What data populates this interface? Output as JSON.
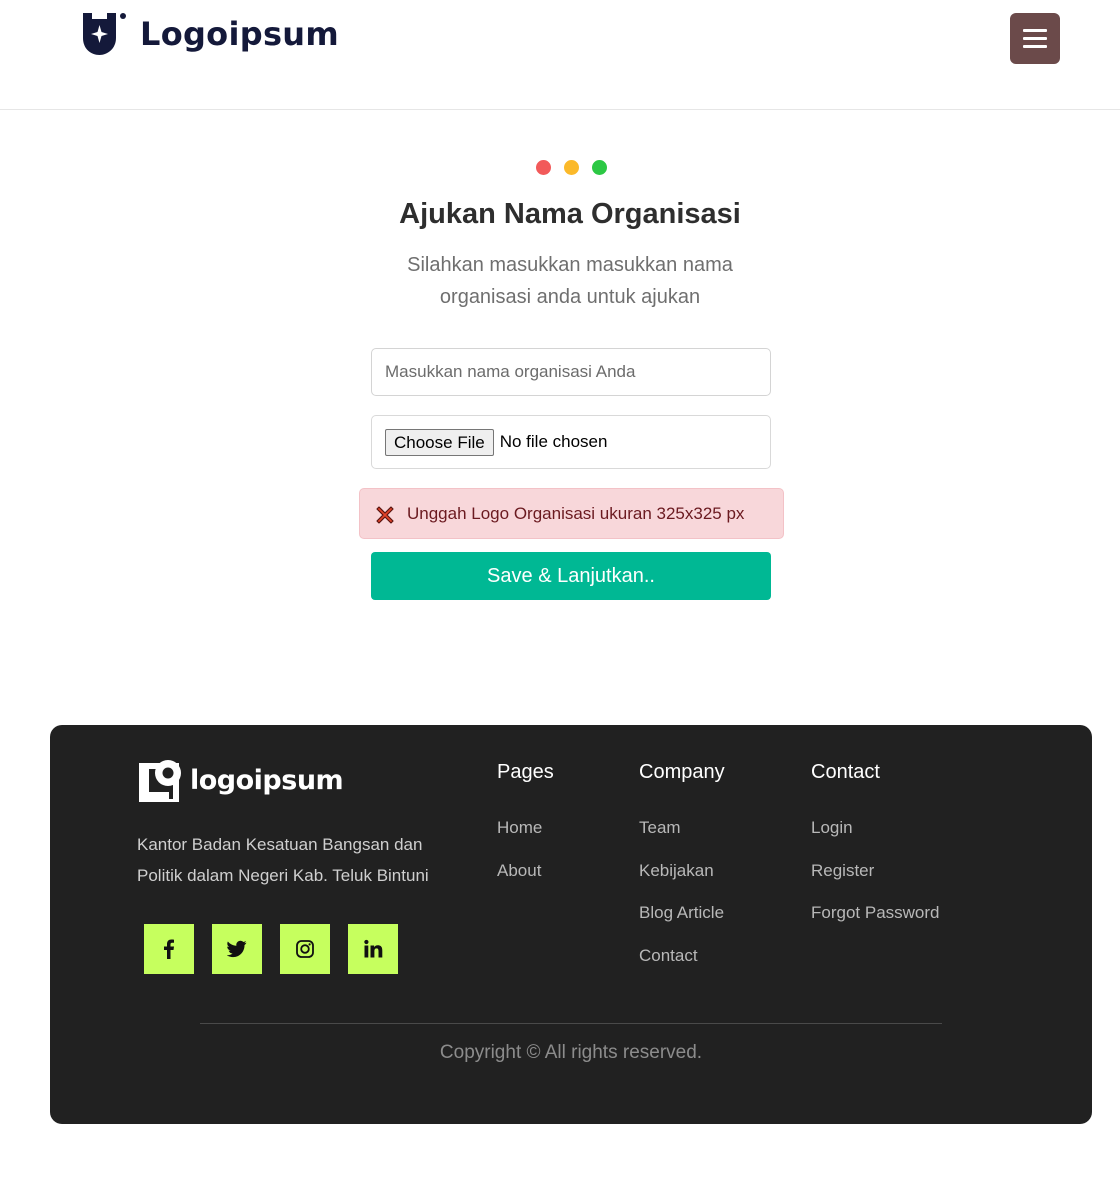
{
  "header": {
    "brand_name": "Logoipsum",
    "brand_color": "#14193a",
    "menu_button_color": "#6b4a4a",
    "menu_icon": "hamburger-icon"
  },
  "main": {
    "dots": [
      "#f25a5a",
      "#fbb92a",
      "#2cc844"
    ],
    "title": "Ajukan Nama Organisasi",
    "subtitle": "Silahkan masukkan masukkan nama organisasi anda untuk ajukan",
    "org_name_placeholder": "Masukkan nama organisasi Anda",
    "file_button_label": "Choose File",
    "file_status": "No file chosen",
    "alert_icon": "red-x-icon",
    "alert_text": "Unggah Logo Organisasi ukuran 325x325 px",
    "save_label": "Save & Lanjutkan..",
    "accent_color": "#00b894"
  },
  "footer": {
    "logo_text": "logoipsum",
    "description": "Kantor Badan Kesatuan Bangsan dan Politik dalam Negeri Kab. Teluk Bintuni",
    "socials": [
      "facebook-icon",
      "twitter-icon",
      "instagram-icon",
      "linkedin-icon"
    ],
    "social_color": "#c6ff5e",
    "pages": {
      "heading": "Pages",
      "links": [
        "Home",
        "About"
      ]
    },
    "company": {
      "heading": "Company",
      "links": [
        "Team",
        "Kebijakan",
        "Blog Article",
        "Contact"
      ]
    },
    "contact": {
      "heading": "Contact",
      "links": [
        "Login",
        "Register",
        "Forgot Password"
      ]
    },
    "copyright": "Copyright © All rights reserved."
  }
}
